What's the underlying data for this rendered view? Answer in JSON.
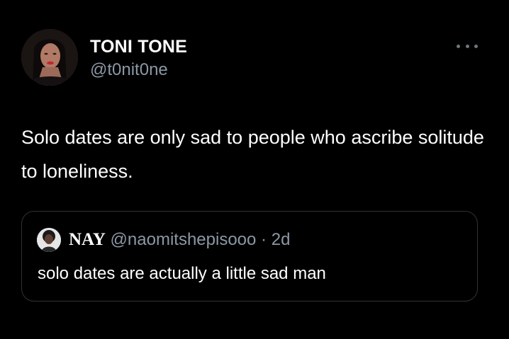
{
  "tweet": {
    "author": {
      "name": "TONI TONE",
      "handle": "@t0nit0ne"
    },
    "text": "Solo dates are only sad to people who ascribe solitude to loneliness.",
    "more_icon": "more-horizontal-icon",
    "quoted": {
      "name": "NAY",
      "handle": "@naomitshepisooo",
      "separator": "·",
      "time": "2d",
      "text": "solo dates are actually a little sad man"
    }
  },
  "colors": {
    "background": "#000000",
    "text": "#ffffff",
    "secondary_text": "#8b98a5",
    "border": "#2f3336",
    "icon": "#6e767d"
  }
}
